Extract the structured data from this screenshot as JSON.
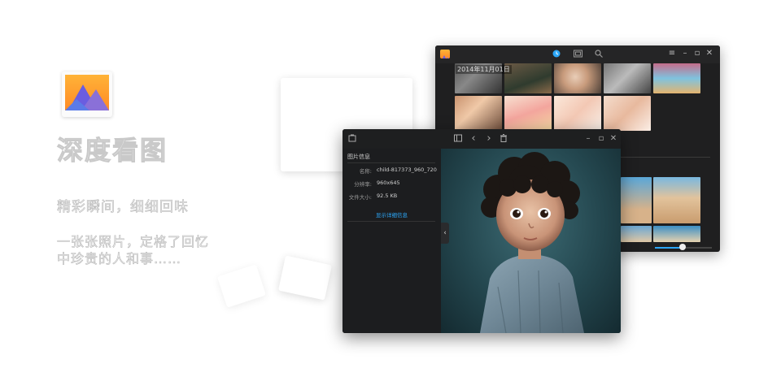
{
  "promo": {
    "app_name": "深度看图",
    "tagline_1": "精彩瞬间，细细回味",
    "tagline_2": "一张张照片，定格了回忆",
    "tagline_3": "中珍贵的人和事……"
  },
  "library_window": {
    "date_label": "2014年11月01日",
    "toolbar_icons": [
      "timeline-icon",
      "album-icon",
      "search-icon"
    ],
    "window_controls": [
      "menu-icon",
      "minimize-icon",
      "maximize-icon",
      "close-icon"
    ],
    "zoom_slider_value": 0.5
  },
  "viewer_window": {
    "toolbar_icons": [
      "fit-window-icon",
      "previous-icon",
      "next-icon",
      "delete-icon"
    ],
    "window_controls": [
      "minimize-icon",
      "maximize-icon",
      "close-icon"
    ],
    "info_panel": {
      "title": "图片信息",
      "rows": [
        {
          "key": "名称:",
          "value": "child-817373_960_720"
        },
        {
          "key": "分辨率:",
          "value": "960x645"
        },
        {
          "key": "文件大小:",
          "value": "92.5 KB"
        }
      ],
      "details_link": "显示详细信息"
    }
  },
  "colors": {
    "accent": "#2ca7f8",
    "logo_orange": "#ff9a2e",
    "logo_purple": "#6a5de0",
    "window_bg": "#1f1f20"
  }
}
